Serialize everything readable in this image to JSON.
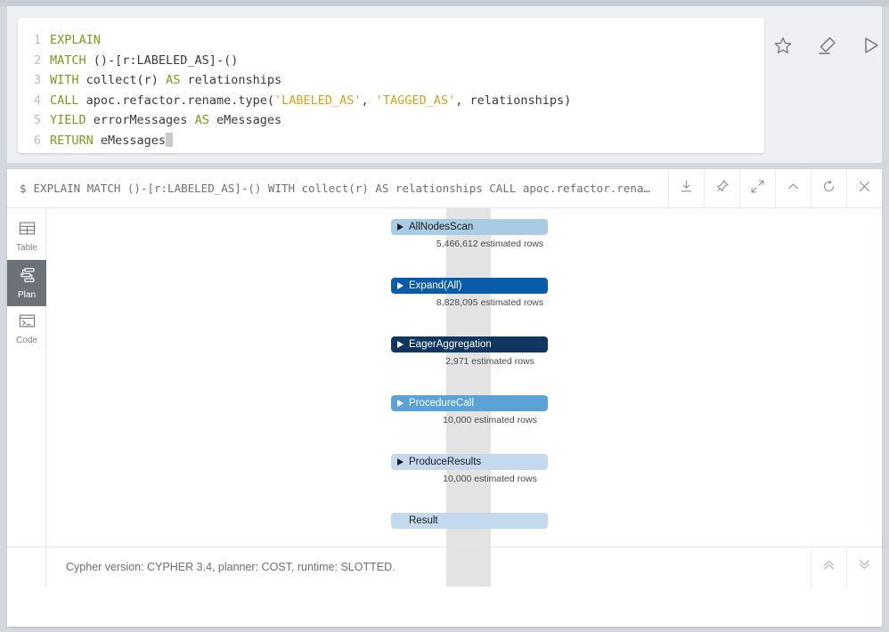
{
  "top_strip": {
    "faint_text": ""
  },
  "editor": {
    "lines": [
      {
        "num": "1",
        "tokens": [
          {
            "t": "kw",
            "v": "EXPLAIN"
          }
        ]
      },
      {
        "num": "2",
        "tokens": [
          {
            "t": "kw",
            "v": "MATCH"
          },
          {
            "t": "txt",
            "v": " ()-[r:LABELED_AS]-()"
          }
        ]
      },
      {
        "num": "3",
        "tokens": [
          {
            "t": "kw",
            "v": "WITH"
          },
          {
            "t": "txt",
            "v": " collect(r) "
          },
          {
            "t": "kw",
            "v": "AS"
          },
          {
            "t": "txt",
            "v": " relationships"
          }
        ]
      },
      {
        "num": "4",
        "tokens": [
          {
            "t": "kw",
            "v": "CALL"
          },
          {
            "t": "txt",
            "v": " apoc.refactor.rename.type("
          },
          {
            "t": "str",
            "v": "'LABELED_AS'"
          },
          {
            "t": "txt",
            "v": ", "
          },
          {
            "t": "str",
            "v": "'TAGGED_AS'"
          },
          {
            "t": "txt",
            "v": ", relationships)"
          }
        ]
      },
      {
        "num": "5",
        "tokens": [
          {
            "t": "kw",
            "v": "YIELD"
          },
          {
            "t": "txt",
            "v": " errorMessages "
          },
          {
            "t": "kw",
            "v": "AS"
          },
          {
            "t": "txt",
            "v": " eMessages"
          }
        ]
      },
      {
        "num": "6",
        "tokens": [
          {
            "t": "kw",
            "v": "RETURN"
          },
          {
            "t": "txt",
            "v": " eMessages"
          }
        ]
      }
    ],
    "actions": [
      {
        "name": "favorite-button",
        "icon": "star-icon"
      },
      {
        "name": "clear-button",
        "icon": "eraser-icon"
      },
      {
        "name": "run-button",
        "icon": "play-icon"
      }
    ]
  },
  "frame": {
    "prompt": "$",
    "query": "EXPLAIN  MATCH ()-[r:LABELED_AS]-() WITH collect(r) AS relationships CALL apoc.refactor.rena…",
    "tools": [
      {
        "name": "download-button",
        "icon": "download-icon"
      },
      {
        "name": "pin-button",
        "icon": "pin-icon"
      },
      {
        "name": "fullscreen-button",
        "icon": "expand-icon"
      },
      {
        "name": "collapse-button",
        "icon": "chevron-up-icon"
      },
      {
        "name": "refresh-button",
        "icon": "refresh-icon"
      },
      {
        "name": "close-button",
        "icon": "close-icon"
      }
    ],
    "tabs": [
      {
        "label": "Table",
        "icon": "table-icon",
        "active": false
      },
      {
        "label": "Plan",
        "icon": "plan-icon",
        "active": true
      },
      {
        "label": "Code",
        "icon": "code-icon",
        "active": false
      }
    ],
    "footer": {
      "status": "Cypher version: CYPHER 3.4, planner: COST, runtime: SLOTTED.",
      "buttons": [
        {
          "name": "scroll-top-button",
          "icon": "double-chevron-up-icon"
        },
        {
          "name": "scroll-bottom-button",
          "icon": "double-chevron-down-icon"
        }
      ]
    }
  },
  "plan": {
    "operators": [
      {
        "name": "AllNodesScan",
        "rows": "5,466,612 estimated rows",
        "bg": "#a8cce4",
        "fg": "#1c1c1c",
        "expandable": true
      },
      {
        "name": "Expand(All)",
        "rows": "8,828,095 estimated rows",
        "bg": "#0a5ca8",
        "fg": "#ffffff",
        "expandable": true
      },
      {
        "name": "EagerAggregation",
        "rows": "2,971 estimated rows",
        "bg": "#10355f",
        "fg": "#ffffff",
        "expandable": true
      },
      {
        "name": "ProcedureCall",
        "rows": "10,000 estimated rows",
        "bg": "#5ba3d6",
        "fg": "#ffffff",
        "expandable": true
      },
      {
        "name": "ProduceResults",
        "rows": "10,000 estimated rows",
        "bg": "#c4d9ed",
        "fg": "#1c1c1c",
        "expandable": true
      },
      {
        "name": "Result",
        "rows": "",
        "bg": "#c4d9ed",
        "fg": "#1c1c1c",
        "expandable": false
      }
    ]
  },
  "colors": {
    "keyword": "#7b9a1e",
    "string": "#d7a219",
    "page_bg": "#d4d7de",
    "editor_bg": "#eff0f4",
    "active_tab": "#6d7278",
    "connector_band": "#e3e3e3"
  }
}
